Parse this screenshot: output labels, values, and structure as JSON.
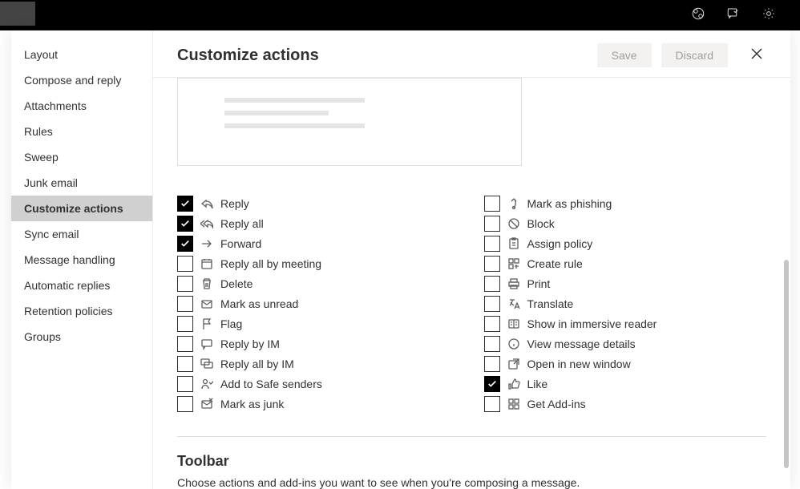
{
  "header_icons": [
    "skype-icon",
    "feedback-icon",
    "settings-gear-icon"
  ],
  "sidebar": {
    "items": [
      {
        "label": "Layout"
      },
      {
        "label": "Compose and reply"
      },
      {
        "label": "Attachments"
      },
      {
        "label": "Rules"
      },
      {
        "label": "Sweep"
      },
      {
        "label": "Junk email"
      },
      {
        "label": "Customize actions",
        "active": true
      },
      {
        "label": "Sync email"
      },
      {
        "label": "Message handling"
      },
      {
        "label": "Automatic replies"
      },
      {
        "label": "Retention policies"
      },
      {
        "label": "Groups"
      }
    ]
  },
  "page": {
    "title": "Customize actions",
    "save": "Save",
    "discard": "Discard"
  },
  "options_left": [
    {
      "label": "Reply",
      "icon": "reply-icon",
      "checked": true
    },
    {
      "label": "Reply all",
      "icon": "reply-all-icon",
      "checked": true
    },
    {
      "label": "Forward",
      "icon": "forward-icon",
      "checked": true
    },
    {
      "label": "Reply all by meeting",
      "icon": "calendar-icon",
      "checked": false
    },
    {
      "label": "Delete",
      "icon": "trash-icon",
      "checked": false
    },
    {
      "label": "Mark as unread",
      "icon": "mail-icon",
      "checked": false
    },
    {
      "label": "Flag",
      "icon": "flag-icon",
      "checked": false
    },
    {
      "label": "Reply by IM",
      "icon": "chat-icon",
      "checked": false
    },
    {
      "label": "Reply all by IM",
      "icon": "chat-all-icon",
      "checked": false
    },
    {
      "label": "Add to Safe senders",
      "icon": "safe-sender-icon",
      "checked": false
    },
    {
      "label": "Mark as junk",
      "icon": "mail-junk-icon",
      "checked": false
    }
  ],
  "options_right": [
    {
      "label": "Mark as phishing",
      "icon": "phishing-icon",
      "checked": false
    },
    {
      "label": "Block",
      "icon": "block-icon",
      "checked": false
    },
    {
      "label": "Assign policy",
      "icon": "policy-icon",
      "checked": false
    },
    {
      "label": "Create rule",
      "icon": "rule-icon",
      "checked": false
    },
    {
      "label": "Print",
      "icon": "print-icon",
      "checked": false
    },
    {
      "label": "Translate",
      "icon": "translate-icon",
      "checked": false
    },
    {
      "label": "Show in immersive reader",
      "icon": "reader-icon",
      "checked": false
    },
    {
      "label": "View message details",
      "icon": "details-icon",
      "checked": false
    },
    {
      "label": "Open in new window",
      "icon": "new-window-icon",
      "checked": false
    },
    {
      "label": "Like",
      "icon": "like-icon",
      "checked": true
    },
    {
      "label": "Get Add-ins",
      "icon": "addins-icon",
      "checked": false
    }
  ],
  "toolbar_section": {
    "heading": "Toolbar",
    "text": "Choose actions and add-ins you want to see when you're composing a message."
  }
}
